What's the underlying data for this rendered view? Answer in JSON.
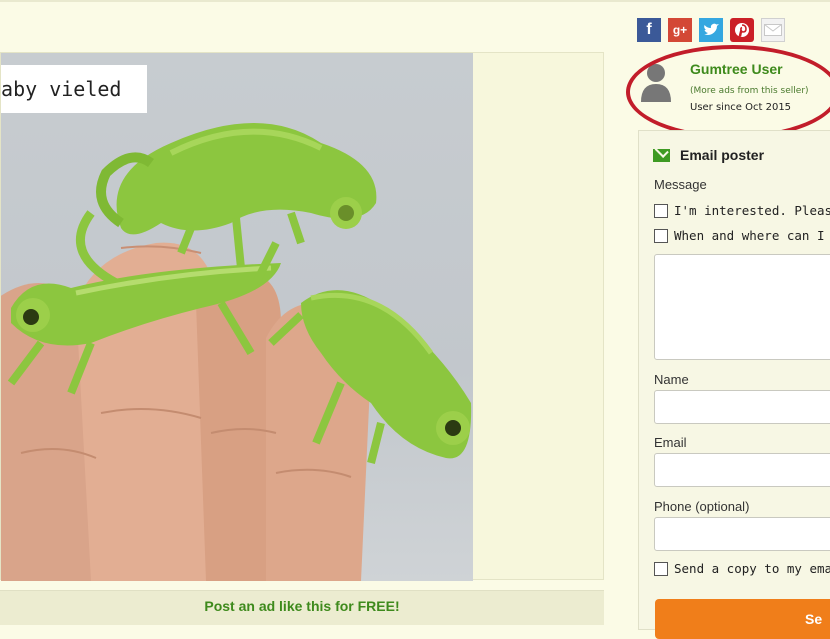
{
  "ad": {
    "title_overlay": "baby vieled"
  },
  "banner": {
    "post_ad": "Post an ad like this for FREE!"
  },
  "share": {
    "icons": [
      "facebook-icon",
      "google-plus-icon",
      "twitter-icon",
      "pinterest-icon",
      "email-icon"
    ],
    "colors": {
      "facebook": "#3b5998",
      "google_plus": "#d34836",
      "twitter": "#35a7e0",
      "pinterest": "#cb2027"
    }
  },
  "seller": {
    "name": "Gumtree User",
    "more_ads": "(More ads from this seller)",
    "since": "User since Oct 2015"
  },
  "email_form": {
    "heading": "Email poster",
    "message_label": "Message",
    "quick_option_1": "I'm interested. Please co",
    "quick_option_2": "When and where can I s",
    "name_label": "Name",
    "email_label": "Email",
    "phone_label": "Phone (optional)",
    "copy_label": "Send a copy to my emai",
    "send_button": "Se"
  },
  "theme": {
    "accent_green": "#3e8a1c",
    "button_orange": "#f07e1a",
    "highlight_red": "#c21d2a"
  }
}
